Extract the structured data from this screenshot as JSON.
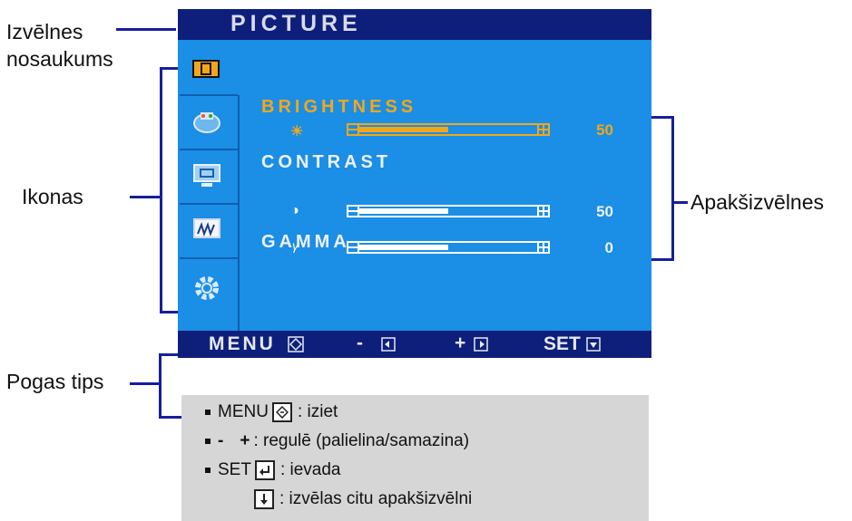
{
  "callouts": {
    "menu_name": "Izvēlnes\nnosaukums",
    "menu_name_l1": "Izvēlnes",
    "menu_name_l2": "nosaukums",
    "icons": "Ikonas",
    "submenus": "Apakšizvēlnes",
    "button_tips": "Pogas tips"
  },
  "osd": {
    "title": "PICTURE",
    "side_icons": [
      "picture-icon",
      "color-icon",
      "display-icon",
      "tracking-icon",
      "setup-icon"
    ],
    "items": [
      {
        "label": "BRIGHTNESS",
        "value": "50",
        "level": 0.5,
        "selected": true,
        "icon": "sun-icon"
      },
      {
        "label": "CONTRAST",
        "value": "50",
        "level": 0.5,
        "selected": false,
        "icon": "contrast-icon"
      },
      {
        "label": "GAMMA",
        "value": "0",
        "level": 0.5,
        "selected": false,
        "icon": "gamma-icon"
      }
    ],
    "icon_glyphs": {
      "sun": "☀",
      "contrast": "◑",
      "gamma": "γ"
    },
    "footer": {
      "menu": "MENU",
      "minus": "-",
      "plus": "+",
      "set": "SET"
    }
  },
  "tips": {
    "row1_key": "MENU",
    "row1_text": ": iziet",
    "row2_minus": "-",
    "row2_plus": "+",
    "row2_text": ": regulē (palielina/samazina)",
    "row3_key": "SET",
    "row3_text": ": ievada",
    "row4_text": ": izvēlas citu apakšizvēlni"
  },
  "colors": {
    "osd_bg": "#1b8ee6",
    "osd_bar": "#0d1f7a",
    "selected": "#f2a71a",
    "callout_line": "#16209a",
    "tips_bg": "#d6d6d6"
  }
}
